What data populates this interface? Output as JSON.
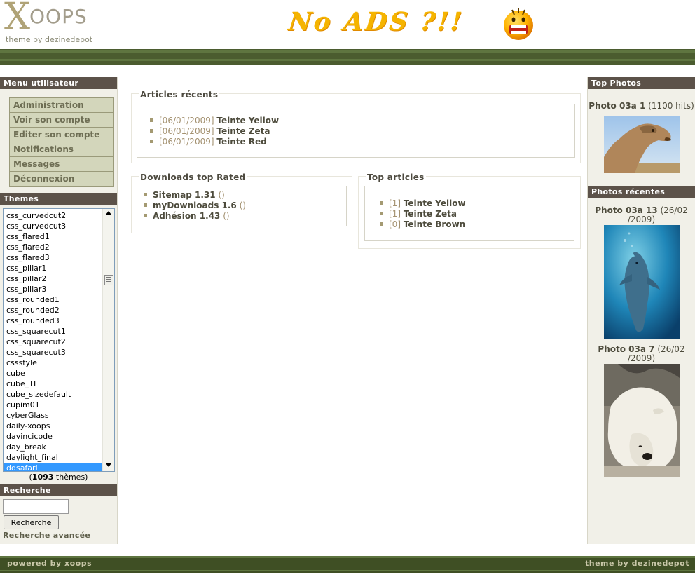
{
  "header": {
    "logo_x": "X",
    "logo_rest": "OOPS",
    "logo_tagline": "theme by dezinedepot",
    "banner_text": "No ADS ?!!"
  },
  "user_menu": {
    "title": "Menu utilisateur",
    "items": [
      {
        "label": "Administration"
      },
      {
        "label": "Voir son compte"
      },
      {
        "label": "Editer son compte"
      },
      {
        "label": "Notifications"
      },
      {
        "label": "Messages"
      },
      {
        "label": "Déconnexion"
      }
    ]
  },
  "themes": {
    "title": "Themes",
    "options": [
      "css_curvedcut2",
      "css_curvedcut3",
      "css_flared1",
      "css_flared2",
      "css_flared3",
      "css_pillar1",
      "css_pillar2",
      "css_pillar3",
      "css_rounded1",
      "css_rounded2",
      "css_rounded3",
      "css_squarecut1",
      "css_squarecut2",
      "css_squarecut3",
      "cssstyle",
      "cube",
      "cube_TL",
      "cube_sizedefault",
      "cupim01",
      "cyberGlass",
      "daily-xoops",
      "davincicode",
      "day_break",
      "daylight_final",
      "ddsafari"
    ],
    "selected": "ddsafari",
    "count": "1093",
    "count_suffix": " thèmes)",
    "count_prefix": "("
  },
  "search": {
    "title": "Recherche",
    "input_value": "",
    "button_label": "Recherche",
    "advanced_label": "Recherche avancée"
  },
  "recent_articles": {
    "title": "Articles récents",
    "items": [
      {
        "date": "[06/01/2009]",
        "title": "Teinte Yellow"
      },
      {
        "date": "[06/01/2009]",
        "title": "Teinte Zeta"
      },
      {
        "date": "[06/01/2009]",
        "title": "Teinte Red"
      }
    ]
  },
  "downloads": {
    "title": "Downloads top Rated",
    "items": [
      {
        "title": "Sitemap 1.31",
        "extra": "()"
      },
      {
        "title": "myDownloads 1.6",
        "extra": "()"
      },
      {
        "title": "Adhésion 1.43",
        "extra": "()"
      }
    ]
  },
  "top_articles": {
    "title": "Top articles",
    "items": [
      {
        "rank": "[1]",
        "title": "Teinte Yellow"
      },
      {
        "rank": "[1]",
        "title": "Teinte Zeta"
      },
      {
        "rank": "[0]",
        "title": "Teinte Brown"
      }
    ]
  },
  "top_photos": {
    "title": "Top Photos",
    "photo_name": "Photo 03a 1",
    "photo_meta": "(1100 hits)"
  },
  "recent_photos": {
    "title": "Photos récentes",
    "photos": [
      {
        "name": "Photo 03a 13",
        "meta": "(26/02 /2009)"
      },
      {
        "name": "Photo 03a 7",
        "meta": "(26/02 /2009)"
      }
    ]
  },
  "footer": {
    "left": "powered by xoops",
    "right": "theme by dezinedepot"
  },
  "colors": {
    "header_bar": "#4b5c2f",
    "block_title_bg": "#5c5249",
    "menu_item_bg": "#d3d6bb",
    "banner_yellow": "#f5b400"
  }
}
